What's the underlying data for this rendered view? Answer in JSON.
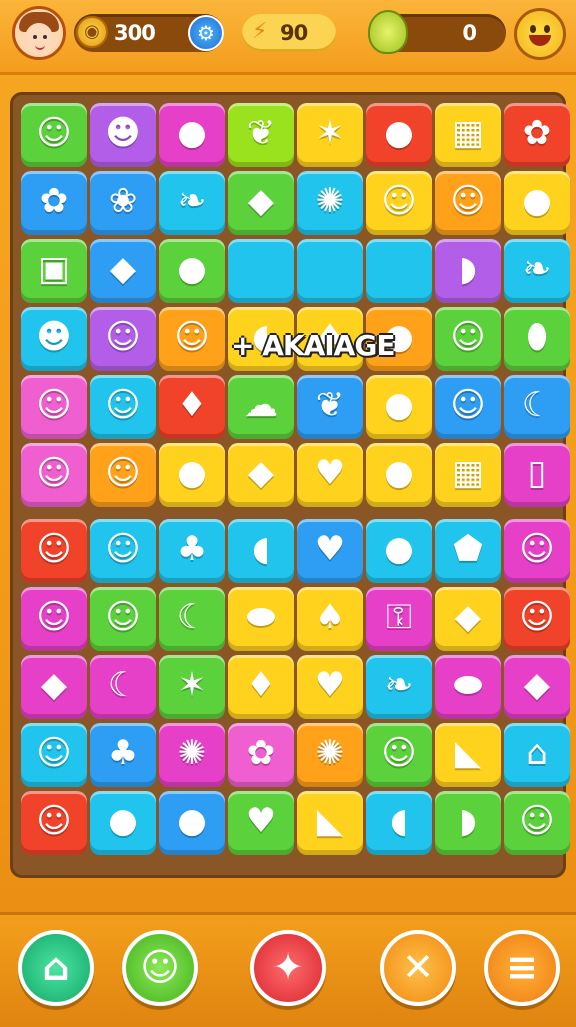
{
  "hud": {
    "coins": "300",
    "bolts": "90",
    "energy": "0",
    "energy_fraction": 0.15
  },
  "board": {
    "combo_text": "+ AKAIAGE",
    "rows": [
      [
        [
          "green",
          "face-icon"
        ],
        [
          "purple",
          "boy-face-icon"
        ],
        [
          "magenta",
          "plum-icon"
        ],
        [
          "lime",
          "leaf-icon"
        ],
        [
          "yellow",
          "star-fruit-icon"
        ],
        [
          "red",
          "pomegranate-icon"
        ],
        [
          "yellow",
          "building-icon"
        ],
        [
          "red",
          "blob-icon"
        ]
      ],
      [
        [
          "blue",
          "flower-icon"
        ],
        [
          "blue",
          "rose-icon"
        ],
        [
          "cyan",
          "leaves-icon"
        ],
        [
          "green",
          "seed-icon"
        ],
        [
          "cyan",
          "grape-icon"
        ],
        [
          "yellow",
          "lemon-face-icon"
        ],
        [
          "orange",
          "bald-face-icon"
        ],
        [
          "yellow",
          "tomato-icon"
        ]
      ],
      [
        [
          "green",
          "box-icon"
        ],
        [
          "blue",
          "husk-icon"
        ],
        [
          "green",
          "lime-icon"
        ],
        [
          "cyan",
          "empty"
        ],
        [
          "cyan",
          "empty"
        ],
        [
          "cyan",
          "empty"
        ],
        [
          "purple",
          "cap-icon"
        ],
        [
          "cyan",
          "leaves-icon"
        ]
      ],
      [
        [
          "cyan",
          "purple-face-icon"
        ],
        [
          "purple",
          "smile-icon"
        ],
        [
          "orange",
          "hat-face-icon"
        ],
        [
          "yellow",
          "bean-icon"
        ],
        [
          "yellow",
          "fig-icon"
        ],
        [
          "orange",
          "lemon-icon"
        ],
        [
          "green",
          "orange-face-icon"
        ],
        [
          "green",
          "avocado-icon"
        ]
      ],
      [
        [
          "pink",
          "round-face-icon"
        ],
        [
          "cyan",
          "hat-boy-icon"
        ],
        [
          "red",
          "pepper-icon"
        ],
        [
          "green",
          "ghost-icon"
        ],
        [
          "blue",
          "leaf-icon"
        ],
        [
          "yellow",
          "apple-icon"
        ],
        [
          "blue",
          "frog-face-icon"
        ],
        [
          "blue",
          "banana-icon"
        ]
      ],
      [
        [
          "pink",
          "man-face-icon"
        ],
        [
          "orange",
          "glasses-face-icon"
        ],
        [
          "yellow",
          "lime-icon"
        ],
        [
          "yellow",
          "yam-icon"
        ],
        [
          "yellow",
          "strawberry-icon"
        ],
        [
          "yellow",
          "orange-icon"
        ],
        [
          "yellow",
          "building-icon"
        ],
        [
          "magenta",
          "trash-icon"
        ]
      ],
      [
        [
          "red",
          "kid-face-icon"
        ],
        [
          "cyan",
          "smile-icon"
        ],
        [
          "cyan",
          "sprout-icon"
        ],
        [
          "cyan",
          "bean-icon"
        ],
        [
          "blue",
          "berry-icon"
        ],
        [
          "cyan",
          "orange-icon"
        ],
        [
          "cyan",
          "tag-icon"
        ],
        [
          "magenta",
          "girl-face-icon"
        ]
      ],
      [
        [
          "magenta",
          "round-face-icon"
        ],
        [
          "green",
          "cap-boy-icon"
        ],
        [
          "green",
          "banana-bunch-icon"
        ],
        [
          "yellow",
          "jelly-icon"
        ],
        [
          "yellow",
          "fig-icon"
        ],
        [
          "magenta",
          "lock-icon"
        ],
        [
          "yellow",
          "yam-icon"
        ],
        [
          "red",
          "leaf-hat-icon"
        ]
      ],
      [
        [
          "magenta",
          "bag-icon"
        ],
        [
          "magenta",
          "banana-icon"
        ],
        [
          "green",
          "star-fruit-icon"
        ],
        [
          "yellow",
          "pepper-icon"
        ],
        [
          "yellow",
          "strawberry-icon"
        ],
        [
          "cyan",
          "leaves-icon"
        ],
        [
          "magenta",
          "blue-blob-icon"
        ],
        [
          "magenta",
          "husk-icon"
        ]
      ],
      [
        [
          "cyan",
          "smile-icon"
        ],
        [
          "blue",
          "palm-icon"
        ],
        [
          "magenta",
          "grape-icon"
        ],
        [
          "pink",
          "flower-icon"
        ],
        [
          "orange",
          "raspberry-icon"
        ],
        [
          "green",
          "pumpkin-icon"
        ],
        [
          "yellow",
          "carrot-icon"
        ],
        [
          "cyan",
          "house-icon"
        ]
      ],
      [
        [
          "red",
          "smile-icon"
        ],
        [
          "cyan",
          "lime-icon"
        ],
        [
          "blue",
          "plum-icon"
        ],
        [
          "green",
          "berry-icon"
        ],
        [
          "yellow",
          "carrot-icon"
        ],
        [
          "cyan",
          "pickle-icon"
        ],
        [
          "green",
          "corn-icon"
        ],
        [
          "green",
          "smile-icon"
        ]
      ]
    ]
  },
  "nav": {
    "home": "home-icon",
    "pet": "pet-face-icon",
    "bone": "bone-icon",
    "close": "close-icon",
    "menu": "menu-icon"
  }
}
